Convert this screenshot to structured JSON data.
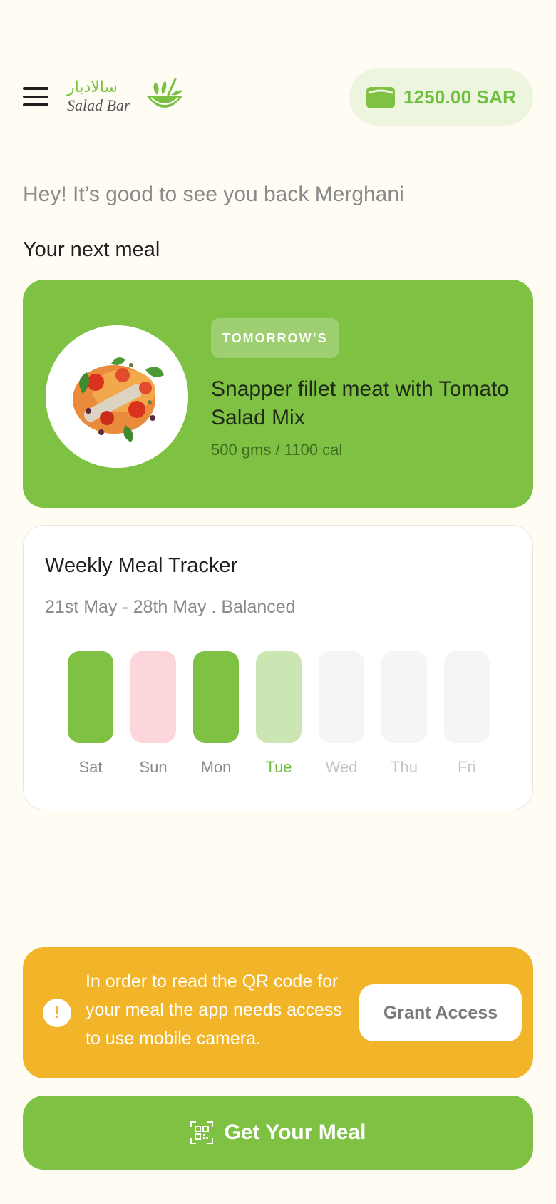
{
  "header": {
    "logo_arabic": "سالادبار",
    "logo_english": "Salad Bar",
    "wallet_amount": "1250.00 SAR"
  },
  "greeting": "Hey! It’s good to see you back Merghani",
  "next_meal": {
    "section_title": "Your next meal",
    "badge": "TOMORROW’S",
    "name": "Snapper fillet meat with Tomato Salad Mix",
    "info": "500 gms / 1100 cal"
  },
  "tracker": {
    "title": "Weekly Meal Tracker",
    "subtitle": "21st May - 28th May . Balanced",
    "days": [
      {
        "label": "Sat",
        "bar_color": "#7ec143",
        "label_color": "#8a8a8a"
      },
      {
        "label": "Sun",
        "bar_color": "#fdd6dc",
        "label_color": "#8a8a8a"
      },
      {
        "label": "Mon",
        "bar_color": "#7ec143",
        "label_color": "#8a8a8a"
      },
      {
        "label": "Tue",
        "bar_color": "#cce6b3",
        "label_color": "#6fbf3f"
      },
      {
        "label": "Wed",
        "bar_color": "#f5f5f3",
        "label_color": "#c4c4c4"
      },
      {
        "label": "Thu",
        "bar_color": "#f5f5f3",
        "label_color": "#c4c4c4"
      },
      {
        "label": "Fri",
        "bar_color": "#f5f5f3",
        "label_color": "#c4c4c4"
      }
    ]
  },
  "alert": {
    "text": "In order to read the QR code for your meal the app needs access to use mobile camera.",
    "button": "Grant Access"
  },
  "cta": {
    "label": "Get Your Meal"
  },
  "colors": {
    "brand_green": "#7ec143",
    "warning_yellow": "#f2b529",
    "background": "#fefcf3"
  }
}
